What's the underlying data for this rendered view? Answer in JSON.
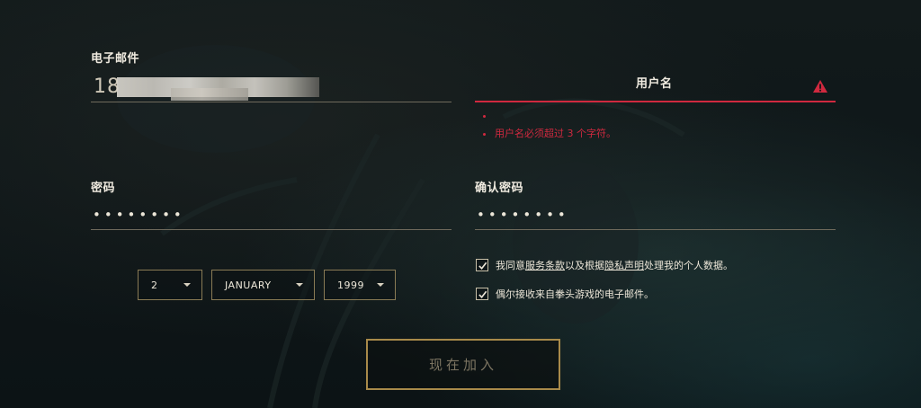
{
  "email": {
    "label": "电子邮件",
    "value_prefix": "18"
  },
  "username": {
    "label": "用户名",
    "warning_icon": "warning-triangle-icon",
    "error_color": "#d0293f",
    "errors": [
      "",
      "用户名必须超过 3 个字符。"
    ]
  },
  "password": {
    "label": "密码",
    "value": "••••••••"
  },
  "confirm_password": {
    "label": "确认密码",
    "value": "••••••••"
  },
  "birthdate": {
    "day": "2",
    "month": "JANUARY",
    "year": "1999"
  },
  "consents": {
    "terms": {
      "checked": true,
      "prefix": "我同意",
      "link1": "服务条款",
      "middle": "以及根据",
      "link2": "隐私声明",
      "suffix": "处理我的个人数据。"
    },
    "marketing": {
      "checked": true,
      "text": "偶尔接收来自拳头游戏的电子邮件。"
    }
  },
  "submit": {
    "label": "现在加入"
  },
  "colors": {
    "accent_gold": "#a88a4a",
    "error_red": "#d0293f"
  }
}
